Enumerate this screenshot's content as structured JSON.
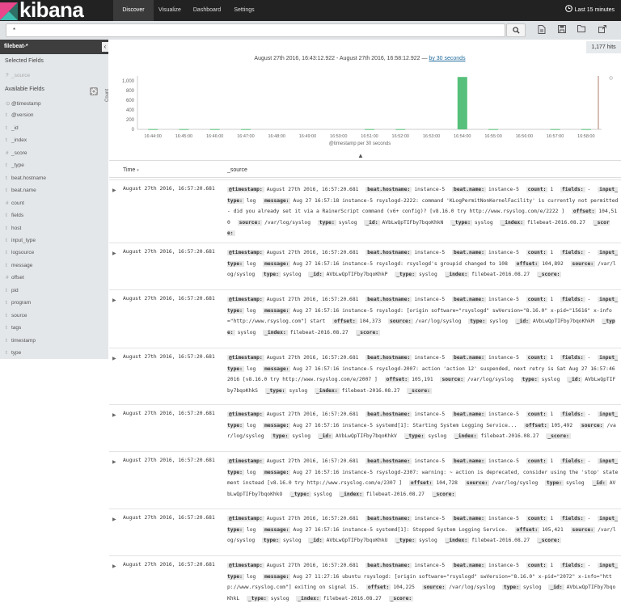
{
  "app": {
    "logo_text": "kibana"
  },
  "nav": [
    {
      "label": "Discover"
    },
    {
      "label": "Visualize"
    },
    {
      "label": "Dashboard"
    },
    {
      "label": "Settings"
    }
  ],
  "time_picker": {
    "label": "Last 15 minutes",
    "icon": "clock-icon"
  },
  "search": {
    "value": "*",
    "button_icon": "search-icon"
  },
  "toolbar_icons": [
    "new-search-icon",
    "save-search-icon",
    "open-search-icon",
    "share-icon"
  ],
  "sidebar": {
    "index_pattern": "filebeat-*",
    "collapse_icon": "‹",
    "selected_title": "Selected Fields",
    "selected_fields": [
      {
        "type": "?",
        "name": "_source"
      }
    ],
    "available_title": "Available Fields",
    "settings_icon": "gear-icon",
    "fields": [
      {
        "type": "⊙",
        "name": "@timestamp"
      },
      {
        "type": "t",
        "name": "@version"
      },
      {
        "type": "t",
        "name": "_id"
      },
      {
        "type": "t",
        "name": "_index"
      },
      {
        "type": "#",
        "name": "_score"
      },
      {
        "type": "t",
        "name": "_type"
      },
      {
        "type": "t",
        "name": "beat.hostname"
      },
      {
        "type": "t",
        "name": "beat.name"
      },
      {
        "type": "#",
        "name": "count"
      },
      {
        "type": "t",
        "name": "fields"
      },
      {
        "type": "t",
        "name": "host"
      },
      {
        "type": "t",
        "name": "input_type"
      },
      {
        "type": "t",
        "name": "logsource"
      },
      {
        "type": "t",
        "name": "message"
      },
      {
        "type": "#",
        "name": "offset"
      },
      {
        "type": "t",
        "name": "pid"
      },
      {
        "type": "t",
        "name": "program"
      },
      {
        "type": "t",
        "name": "source"
      },
      {
        "type": "t",
        "name": "tags"
      },
      {
        "type": "t",
        "name": "timestamp"
      },
      {
        "type": "t",
        "name": "type"
      }
    ]
  },
  "hits": "1,177 hits",
  "time_range": {
    "text": "August 27th 2016, 16:43:12.922 - August 27th 2016, 16:58:12.922 —",
    "interval_link": "by 30 seconds"
  },
  "chart_data": {
    "type": "bar",
    "ylabel": "Count",
    "xlabel": "@timestamp per 30 seconds",
    "y_ticks": [
      "1,000",
      "800",
      "600",
      "400",
      "200",
      "0"
    ],
    "ylim": [
      0,
      1100
    ],
    "x_ticks": [
      "16:44:00",
      "16:45:00",
      "16:46:00",
      "16:47:00",
      "16:48:00",
      "16:49:00",
      "16:50:00",
      "16:51:00",
      "16:52:00",
      "16:53:00",
      "16:54:00",
      "16:55:00",
      "16:56:00",
      "16:57:00",
      "16:58:00"
    ],
    "bars": [
      {
        "x": "16:44:00",
        "value": 5
      },
      {
        "x": "16:45:00",
        "value": 5
      },
      {
        "x": "16:46:00",
        "value": 5
      },
      {
        "x": "16:47:00",
        "value": 5
      },
      {
        "x": "16:51:00",
        "value": 5
      },
      {
        "x": "16:52:00",
        "value": 5
      },
      {
        "x": "16:54:00",
        "value": 1080
      },
      {
        "x": "16:55:00",
        "value": 5
      },
      {
        "x": "16:57:00",
        "value": 5
      },
      {
        "x": "16:58:00",
        "value": 5
      }
    ],
    "colors": {
      "bar": "#57c17b"
    }
  },
  "table": {
    "col_time": "Time",
    "col_source": "_source",
    "expand_icon": "▲",
    "rows": [
      {
        "time": "August 27th 2016, 16:57:20.681",
        "fields": [
          [
            "@timestamp:",
            "August 27th 2016, 16:57:20.681"
          ],
          [
            "beat.hostname:",
            "instance-5"
          ],
          [
            "beat.name:",
            "instance-5"
          ],
          [
            "count:",
            "1"
          ],
          [
            "fields:",
            "-"
          ],
          [
            "input_type:",
            "log"
          ],
          [
            "message:",
            "Aug 27 16:57:18 instance-5 rsyslogd-2222: command 'KLogPermitNonKernelFacility' is currently not permitted - did you already set it via a RainerScript command (v6+ config)? [v8.16.0 try http://www.rsyslog.com/e/2222 ]"
          ],
          [
            "offset:",
            "104,510"
          ],
          [
            "source:",
            "/var/log/syslog"
          ],
          [
            "type:",
            "syslog"
          ],
          [
            "_id:",
            "AVbLwQpTIFby7bqoKhkN"
          ],
          [
            "_type:",
            "syslog"
          ],
          [
            "_index:",
            "filebeat-2016.08.27"
          ],
          [
            "_score:",
            ""
          ]
        ]
      },
      {
        "time": "August 27th 2016, 16:57:20.681",
        "fields": [
          [
            "@timestamp:",
            "August 27th 2016, 16:57:20.681"
          ],
          [
            "beat.hostname:",
            "instance-5"
          ],
          [
            "beat.name:",
            "instance-5"
          ],
          [
            "count:",
            "1"
          ],
          [
            "fields:",
            "-"
          ],
          [
            "input_type:",
            "log"
          ],
          [
            "message:",
            "Aug 27 16:57:16 instance-5 rsyslogd: rsyslogd's groupid changed to 108"
          ],
          [
            "offset:",
            "104,892"
          ],
          [
            "source:",
            "/var/log/syslog"
          ],
          [
            "type:",
            "syslog"
          ],
          [
            "_id:",
            "AVbLwQpTIFby7bqoKhkP"
          ],
          [
            "_type:",
            "syslog"
          ],
          [
            "_index:",
            "filebeat-2016.08.27"
          ],
          [
            "_score:",
            ""
          ]
        ]
      },
      {
        "time": "August 27th 2016, 16:57:20.681",
        "fields": [
          [
            "@timestamp:",
            "August 27th 2016, 16:57:20.681"
          ],
          [
            "beat.hostname:",
            "instance-5"
          ],
          [
            "beat.name:",
            "instance-5"
          ],
          [
            "count:",
            "1"
          ],
          [
            "fields:",
            "-"
          ],
          [
            "input_type:",
            "log"
          ],
          [
            "message:",
            "Aug 27 16:57:16 instance-5 rsyslogd: [origin software=\"rsyslogd\" swVersion=\"8.16.0\" x-pid=\"15616\" x-info=\"http://www.rsyslog.com\"] start"
          ],
          [
            "offset:",
            "104,373"
          ],
          [
            "source:",
            "/var/log/syslog"
          ],
          [
            "type:",
            "syslog"
          ],
          [
            "_id:",
            "AVbLwQpTIFby7bqoKhkM"
          ],
          [
            "_type:",
            "syslog"
          ],
          [
            "_index:",
            "filebeat-2016.08.27"
          ],
          [
            "_score:",
            ""
          ]
        ]
      },
      {
        "time": "August 27th 2016, 16:57:20.681",
        "fields": [
          [
            "@timestamp:",
            "August 27th 2016, 16:57:20.681"
          ],
          [
            "beat.hostname:",
            "instance-5"
          ],
          [
            "beat.name:",
            "instance-5"
          ],
          [
            "count:",
            "1"
          ],
          [
            "fields:",
            "-"
          ],
          [
            "input_type:",
            "log"
          ],
          [
            "message:",
            "Aug 27 16:57:16 instance-5 rsyslogd-2007: action 'action 12' suspended, next retry is Sat Aug 27 16:57:46 2016 [v8.16.0 try http://www.rsyslog.com/e/2007 ]"
          ],
          [
            "offset:",
            "105,191"
          ],
          [
            "source:",
            "/var/log/syslog"
          ],
          [
            "type:",
            "syslog"
          ],
          [
            "_id:",
            "AVbLwQpTIFby7bqoKhkS"
          ],
          [
            "_type:",
            "syslog"
          ],
          [
            "_index:",
            "filebeat-2016.08.27"
          ],
          [
            "_score:",
            ""
          ]
        ]
      },
      {
        "time": "August 27th 2016, 16:57:20.681",
        "fields": [
          [
            "@timestamp:",
            "August 27th 2016, 16:57:20.681"
          ],
          [
            "beat.hostname:",
            "instance-5"
          ],
          [
            "beat.name:",
            "instance-5"
          ],
          [
            "count:",
            "1"
          ],
          [
            "fields:",
            "-"
          ],
          [
            "input_type:",
            "log"
          ],
          [
            "message:",
            "Aug 27 16:57:16 instance-5 systemd[1]: Starting System Logging Service..."
          ],
          [
            "offset:",
            "105,492"
          ],
          [
            "source:",
            "/var/log/syslog"
          ],
          [
            "type:",
            "syslog"
          ],
          [
            "_id:",
            "AVbLwQpTIFby7bqoKhkV"
          ],
          [
            "_type:",
            "syslog"
          ],
          [
            "_index:",
            "filebeat-2016.08.27"
          ],
          [
            "_score:",
            ""
          ]
        ]
      },
      {
        "time": "August 27th 2016, 16:57:20.681",
        "fields": [
          [
            "@timestamp:",
            "August 27th 2016, 16:57:20.681"
          ],
          [
            "beat.hostname:",
            "instance-5"
          ],
          [
            "beat.name:",
            "instance-5"
          ],
          [
            "count:",
            "1"
          ],
          [
            "fields:",
            "-"
          ],
          [
            "input_type:",
            "log"
          ],
          [
            "message:",
            "Aug 27 16:57:16 instance-5 rsyslogd-2307: warning: ~ action is deprecated, consider using the 'stop' statement instead [v8.16.0 try http://www.rsyslog.com/e/2307 ]"
          ],
          [
            "offset:",
            "104,728"
          ],
          [
            "source:",
            "/var/log/syslog"
          ],
          [
            "type:",
            "syslog"
          ],
          [
            "_id:",
            "AVbLwQpTIFby7bqoKhkO"
          ],
          [
            "_type:",
            "syslog"
          ],
          [
            "_index:",
            "filebeat-2016.08.27"
          ],
          [
            "_score:",
            ""
          ]
        ]
      },
      {
        "time": "August 27th 2016, 16:57:20.681",
        "fields": [
          [
            "@timestamp:",
            "August 27th 2016, 16:57:20.681"
          ],
          [
            "beat.hostname:",
            "instance-5"
          ],
          [
            "beat.name:",
            "instance-5"
          ],
          [
            "count:",
            "1"
          ],
          [
            "fields:",
            "-"
          ],
          [
            "input_type:",
            "log"
          ],
          [
            "message:",
            "Aug 27 16:57:16 instance-5 systemd[1]: Stopped System Logging Service."
          ],
          [
            "offset:",
            "105,421"
          ],
          [
            "source:",
            "/var/log/syslog"
          ],
          [
            "type:",
            "syslog"
          ],
          [
            "_id:",
            "AVbLwQpTIFby7bqoKhkU"
          ],
          [
            "_type:",
            "syslog"
          ],
          [
            "_index:",
            "filebeat-2016.08.27"
          ],
          [
            "_score:",
            ""
          ]
        ]
      },
      {
        "time": "August 27th 2016, 16:57:20.681",
        "fields": [
          [
            "@timestamp:",
            "August 27th 2016, 16:57:20.681"
          ],
          [
            "beat.hostname:",
            "instance-5"
          ],
          [
            "beat.name:",
            "instance-5"
          ],
          [
            "count:",
            "1"
          ],
          [
            "fields:",
            "-"
          ],
          [
            "input_type:",
            "log"
          ],
          [
            "message:",
            "Aug 27 11:27:16 ubuntu rsyslogd: [origin software=\"rsyslogd\" swVersion=\"8.16.0\" x-pid=\"2072\" x-info=\"http://www.rsyslog.com\"] exiting on signal 15."
          ],
          [
            "offset:",
            "104,225"
          ],
          [
            "source:",
            "/var/log/syslog"
          ],
          [
            "type:",
            "syslog"
          ],
          [
            "_id:",
            "AVbLwQpTIFby7bqoKhkL"
          ],
          [
            "_type:",
            "syslog"
          ],
          [
            "_index:",
            "filebeat-2016.08.27"
          ],
          [
            "_score:",
            ""
          ]
        ]
      }
    ]
  }
}
